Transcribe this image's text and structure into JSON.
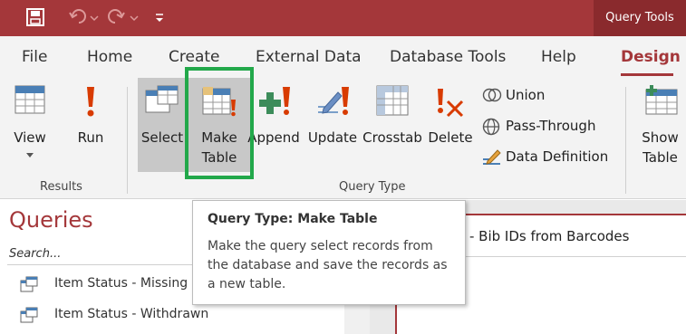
{
  "titlebar": {
    "context_tab": "Query Tools"
  },
  "tabs": [
    "File",
    "Home",
    "Create",
    "External Data",
    "Database Tools",
    "Help",
    "Design"
  ],
  "active_tab": "Design",
  "ribbon": {
    "results": {
      "view": "View",
      "run": "Run",
      "group": "Results"
    },
    "query_type": {
      "select": "Select",
      "make_table_1": "Make",
      "make_table_2": "Table",
      "append": "Append",
      "update": "Update",
      "crosstab": "Crosstab",
      "delete": "Delete",
      "union": "Union",
      "pass_through": "Pass-Through",
      "data_definition": "Data Definition",
      "group": "Query Type"
    },
    "show_table_1": "Show",
    "show_table_2": "Table"
  },
  "nav": {
    "title": "Queries",
    "search_placeholder": "Search...",
    "items": [
      "Item Status - Missing",
      "Item Status - Withdrawn"
    ]
  },
  "document": {
    "tab_title": "- Bib IDs from Barcodes"
  },
  "tooltip": {
    "title": "Query Type: Make Table",
    "body": "Make the query select records from the database and save the records as a new table."
  },
  "colors": {
    "accent": "#a4373a",
    "highlight": "#22a84a"
  }
}
